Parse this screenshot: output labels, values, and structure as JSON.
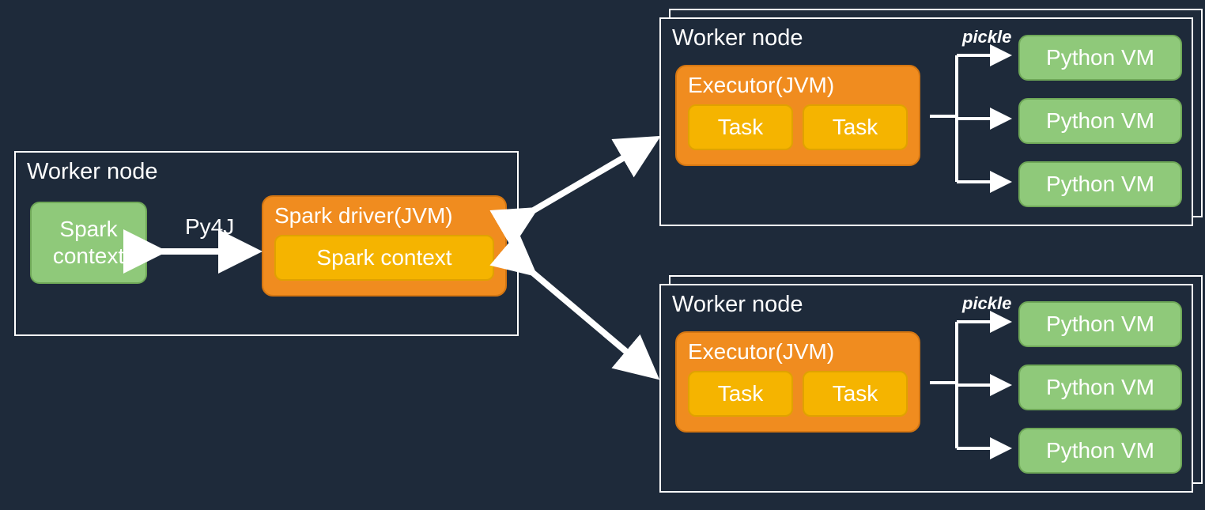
{
  "driver_node": {
    "title": "Worker node",
    "spark_context_py": "Spark\ncontext",
    "driver_label": "Spark driver(JVM)",
    "spark_context_jvm": "Spark context",
    "py4j": "Py4J"
  },
  "worker1": {
    "title": "Worker node",
    "executor": "Executor(JVM)",
    "task1": "Task",
    "task2": "Task",
    "pickle": "pickle",
    "pyvm1": "Python VM",
    "pyvm2": "Python VM",
    "pyvm3": "Python VM"
  },
  "worker2": {
    "title": "Worker node",
    "executor": "Executor(JVM)",
    "task1": "Task",
    "task2": "Task",
    "pickle": "pickle",
    "pyvm1": "Python VM",
    "pyvm2": "Python VM",
    "pyvm3": "Python VM"
  }
}
